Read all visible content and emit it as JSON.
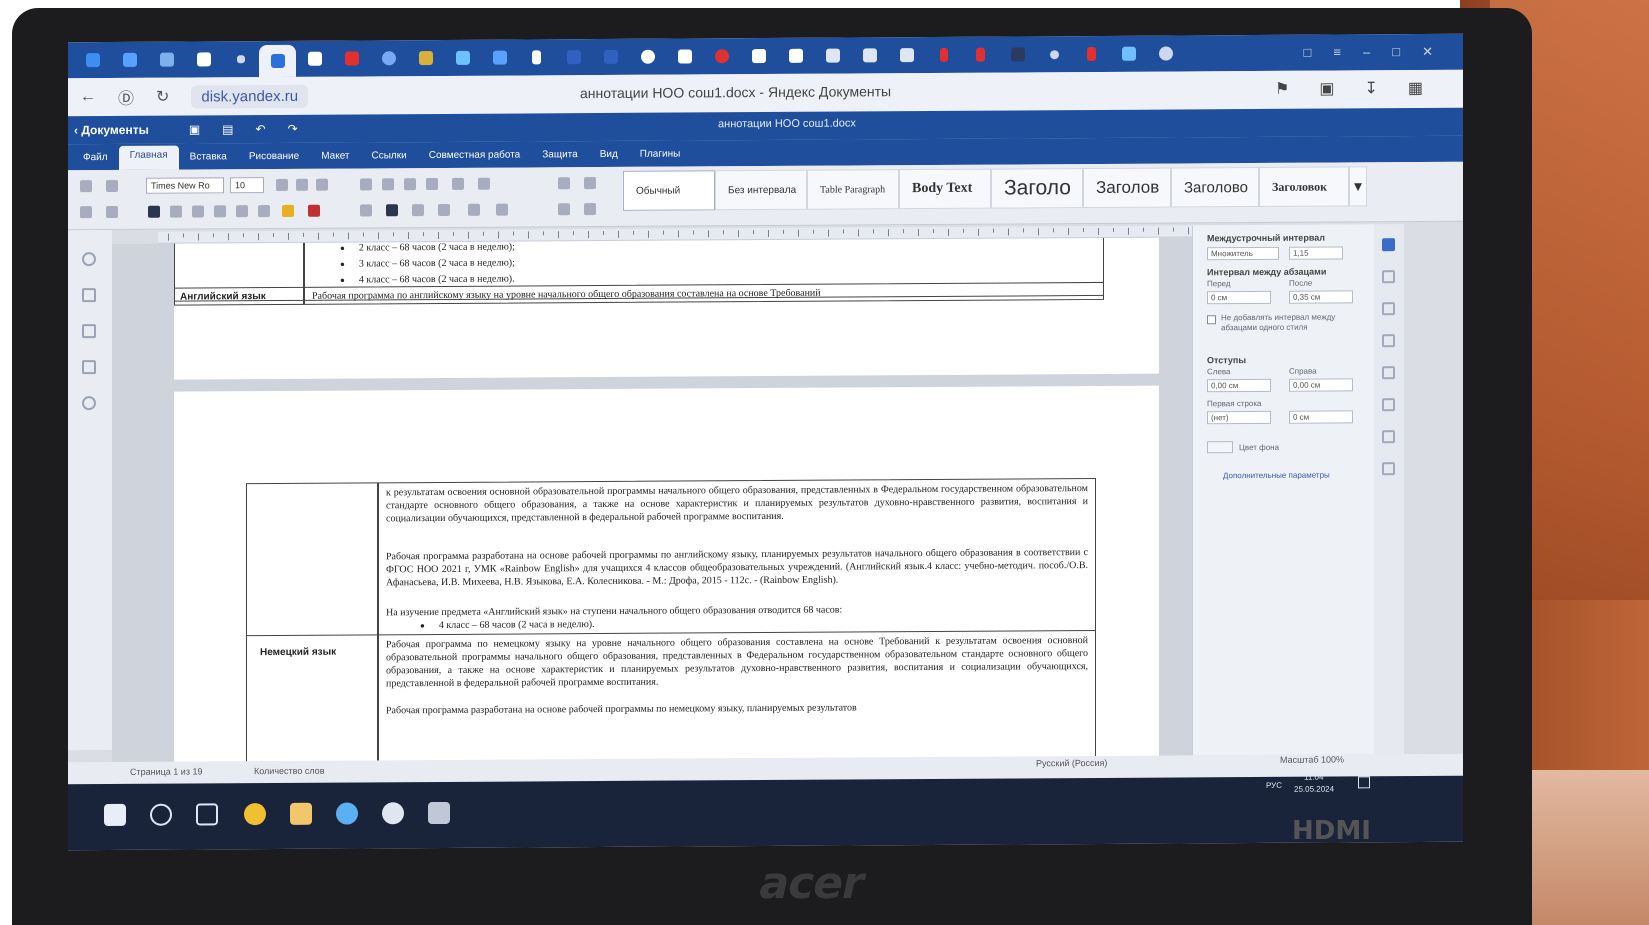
{
  "browser": {
    "url": "disk.yandex.ru",
    "window_title": "аннотации НОО сош1.docx - Яндекс Документы"
  },
  "app": {
    "back_label": "Документы",
    "doc_name": "аннотации НОО сош1.docx",
    "menus": [
      "Файл",
      "Главная",
      "Вставка",
      "Рисование",
      "Макет",
      "Ссылки",
      "Совместная работа",
      "Защита",
      "Вид",
      "Плагины"
    ],
    "active_menu_index": 1,
    "font_name": "Times New Ro",
    "font_size": "10",
    "styles": [
      "Обычный",
      "Без интервала",
      "Table Paragraph",
      "Body Text",
      "Заголо",
      "Заголов",
      "Заголово",
      "Заголовок"
    ]
  },
  "document": {
    "page1": {
      "bullets": [
        "2 класс – 68 часов (2 часа в неделю);",
        "3 класс – 68 часов (2 часа в неделю);",
        "4 класс – 68 часов (2 часа в неделю)."
      ],
      "subject": "Английский язык",
      "text": "Рабочая программа по английскому языку на уровне начального общего образования составлена на основе Требований"
    },
    "page2": {
      "para1": "к результатам освоения основной образовательной программы начального общего образования, представленных в Федеральном государственном образовательном стандарте основного общего образования, а также на основе характеристик и планируемых результатов духовно-нравственного развития, воспитания и социализации обучающихся, представленной в федеральной рабочей программе воспитания.",
      "para2": "Рабочая программа разработана на основе рабочей программы по английскому языку, планируемых результатов начального общего образования в соответствии с ФГОС НОО 2021 г, УМК «Rainbow English» для учащихся 4 классов общеобразовательных учреждений. (Английский язык.4 класс: учебно-методич. пособ./О.В. Афанасьева, И.В. Михеева, Н.В. Языкова, Е.А. Колесникова. - М.: Дрофа, 2015 - 112с. - (Rainbow English).",
      "para3": "На изучение предмета «Английский язык» на ступени начального общего образования отводится 68 часов:",
      "bullet": "4 класс – 68 часов (2 часа в неделю).",
      "subject2": "Немецкий язык",
      "para4": "Рабочая программа по немецкому языку на уровне начального общего образования составлена на основе Требований к результатам освоения основной образовательной программы начального общего образования, представленных в Федеральном государственном образовательном стандарте основного общего образования, а также на основе характеристик и планируемых результатов духовно-нравственного развития, воспитания и социализации обучающихся, представленной в федеральной рабочей программе воспитания.",
      "para5": "Рабочая программа разработана на основе рабочей программы по немецкому языку, планируемых результатов"
    }
  },
  "panel": {
    "title": "Междустрочный интервал",
    "line_spacing_value": "Множитель",
    "line_spacing_num": "1,15",
    "para_spacing_label": "Интервал между абзацами",
    "before_label": "Перед",
    "after_label": "После",
    "before_value": "0 см",
    "after_value": "0,35 см",
    "dont_add_label": "Не добавлять интервал между абзацами одного стиля",
    "indents_label": "Отступы",
    "left_label": "Слева",
    "right_label": "Справа",
    "left_value": "0,00 см",
    "right_value": "0,00 см",
    "first_line_label": "Первая строка",
    "first_line_value": "(нет)",
    "first_line_num": "0 см",
    "bg_color_label": "Цвет фона",
    "advanced_label": "Дополнительные параметры"
  },
  "status": {
    "page": "Страница 1 из 19",
    "words": "Количество слов",
    "lang": "Русский (Россия)",
    "zoom": "Масштаб 100%"
  },
  "taskbar": {
    "lang": "РУС",
    "time": "11:04",
    "date": "25.05.2024"
  },
  "hardware": {
    "brand": "acer",
    "hdmi": "HDMI"
  }
}
